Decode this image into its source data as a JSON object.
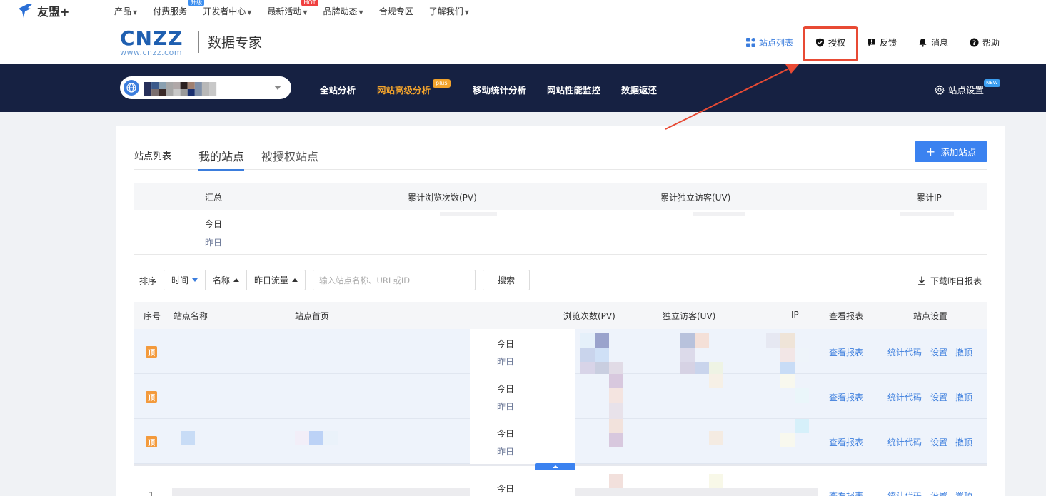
{
  "topnav": {
    "brand": "友盟+",
    "items": [
      {
        "label": "产品",
        "caret": true
      },
      {
        "label": "付费服务",
        "badge": "升级"
      },
      {
        "label": "开发者中心",
        "caret": true
      },
      {
        "label": "最新活动",
        "badge": "HOT",
        "caret": true
      },
      {
        "label": "品牌动态",
        "caret": true
      },
      {
        "label": "合规专区"
      },
      {
        "label": "了解我们",
        "caret": true
      }
    ]
  },
  "header": {
    "logo_big": "CNZZ",
    "logo_small": "www.cnzz.com",
    "product": "数据专家",
    "links": {
      "site_list": "站点列表",
      "auth": "授权",
      "feedback": "反馈",
      "message": "消息",
      "help": "帮助"
    }
  },
  "darkbar": {
    "nav": [
      "全站分析",
      "网站高级分析",
      "移动统计分析",
      "网站性能监控",
      "数据返还"
    ],
    "plus_badge": "plus",
    "site_settings": "站点设置",
    "new_badge": "NEW"
  },
  "card": {
    "tab_label": "站点列表",
    "tabs": [
      "我的站点",
      "被授权站点"
    ],
    "add_button": "添加站点",
    "summary": {
      "headers": [
        "汇总",
        "累计浏览次数(PV)",
        "累计独立访客(UV)",
        "累计IP"
      ],
      "today": "今日",
      "yesterday": "昨日"
    },
    "sort": {
      "label": "排序",
      "options": [
        "时间",
        "名称",
        "昨日流量"
      ],
      "placeholder": "输入站点名称、URL或ID",
      "search_button": "搜索",
      "download": "下载昨日报表"
    },
    "table": {
      "headers": [
        "序号",
        "站点名称",
        "站点首页",
        "浏览次数(PV)",
        "独立访客(UV)",
        "IP",
        "查看报表",
        "站点设置"
      ],
      "top_badge": "顶",
      "today": "今日",
      "yesterday": "昨日",
      "view_report": "查看报表",
      "stat_code": "统计代码",
      "settings": "设置",
      "revoke": "撤顶",
      "set_top": "置顶",
      "row4_index": "1"
    }
  },
  "colors": {
    "accent": "#3b7ddd",
    "dark_nav": "#162142",
    "orange": "#f2a32c",
    "highlight_red": "#e84a34"
  }
}
